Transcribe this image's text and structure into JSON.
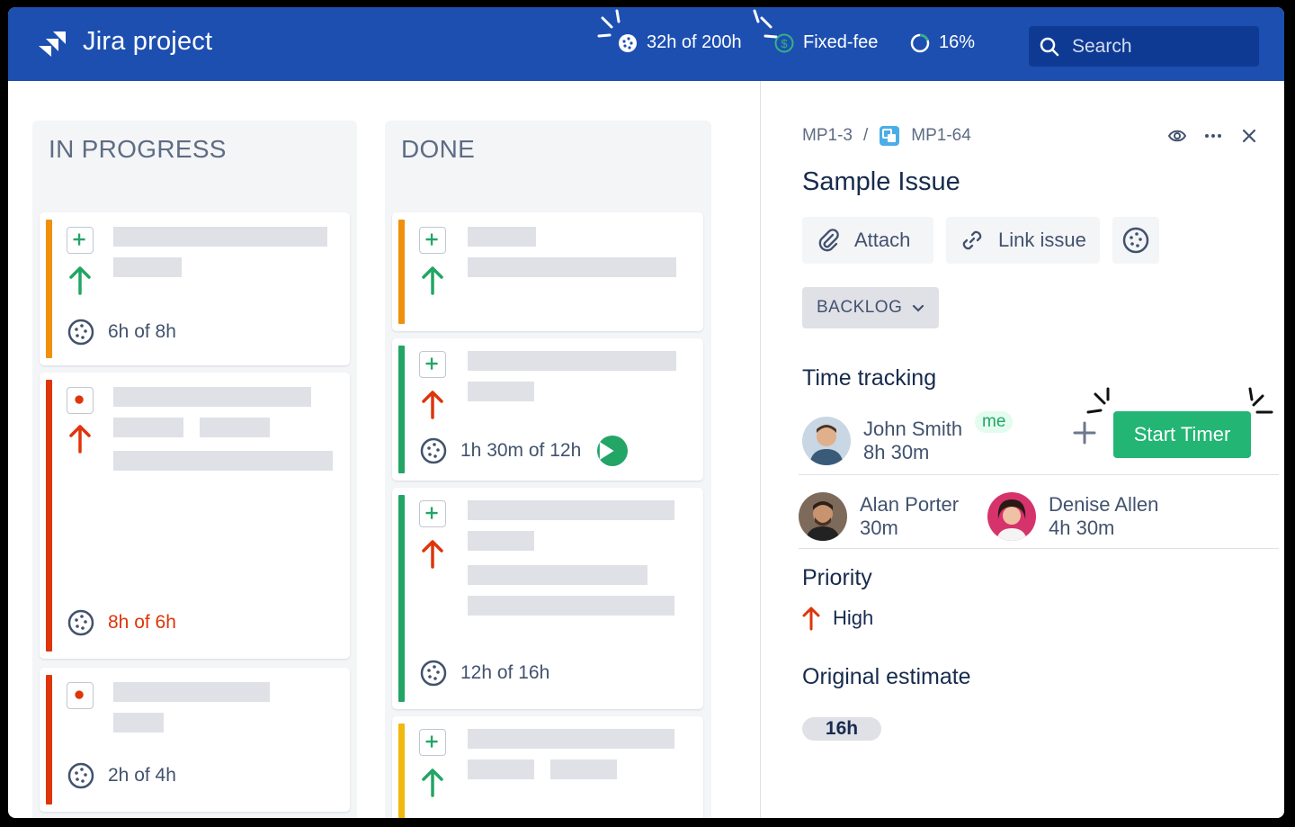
{
  "header": {
    "app_title": "Jira project",
    "logged_time": "32h of 200h",
    "billing": "Fixed-fee",
    "progress": "16%",
    "progress_value": 0.16,
    "search_placeholder": "Search"
  },
  "board": {
    "columns": [
      {
        "title": "IN PROGRESS",
        "cards": [
          {
            "bar_color": "#f0900d",
            "type": "plus",
            "priority": "up-green",
            "time": "6h of 8h",
            "over": false
          },
          {
            "bar_color": "#de350b",
            "type": "dot",
            "priority": "up-red",
            "time": "8h of 6h",
            "over": true
          },
          {
            "bar_color": "#de350b",
            "type": "dot",
            "priority": "none",
            "time": "2h of 4h",
            "over": false
          }
        ]
      },
      {
        "title": "DONE",
        "cards": [
          {
            "bar_color": "#f0900d",
            "type": "plus",
            "priority": "up-green",
            "time": "",
            "over": false
          },
          {
            "bar_color": "#22a565",
            "type": "plus",
            "priority": "up-red",
            "time": "1h 30m of 12h",
            "over": false,
            "playing": true
          },
          {
            "bar_color": "#22a565",
            "type": "plus",
            "priority": "up-red",
            "time": "12h of 16h",
            "over": false
          },
          {
            "bar_color": "#f0b90d",
            "type": "plus",
            "priority": "up-green",
            "time": "",
            "over": false
          }
        ]
      }
    ]
  },
  "panel": {
    "breadcrumb_parent": "MP1-3",
    "breadcrumb_sep": "/",
    "breadcrumb_issue": "MP1-64",
    "title": "Sample Issue",
    "attach_label": "Attach",
    "link_label": "Link issue",
    "status_label": "BACKLOG",
    "time_tracking_heading": "Time tracking",
    "users": [
      {
        "name": "John Smith",
        "time": "8h 30m",
        "badge": "me"
      },
      {
        "name": "Alan Porter",
        "time": "30m"
      },
      {
        "name": "Denise Allen",
        "time": "4h 30m"
      }
    ],
    "start_timer_label": "Start Timer",
    "priority_heading": "Priority",
    "priority_value": "High",
    "estimate_heading": "Original estimate",
    "estimate_value": "16h"
  },
  "colors": {
    "header_bg": "#1d4fb1",
    "accent_green": "#22b573",
    "priority_red": "#de350b",
    "priority_green": "#22a565"
  },
  "icons": [
    "jira-logo-icon",
    "timer-icon",
    "dollar-icon",
    "progress-ring-icon",
    "search-icon",
    "eye-icon",
    "more-icon",
    "close-icon",
    "paperclip-icon",
    "link-icon",
    "chevron-down-icon",
    "plus-icon",
    "arrow-up-icon",
    "play-icon"
  ]
}
